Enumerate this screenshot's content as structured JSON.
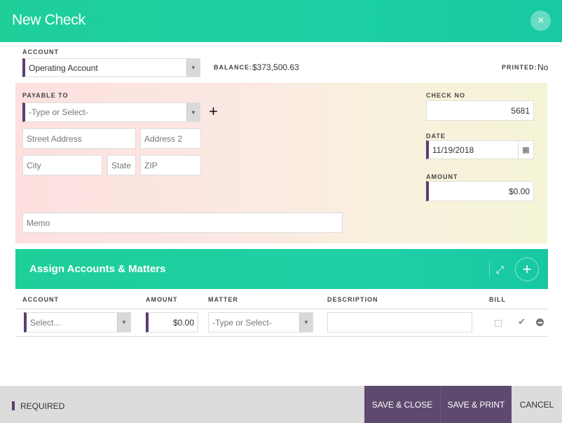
{
  "dialog": {
    "title": "New Check",
    "close_icon": "×"
  },
  "account": {
    "label": "ACCOUNT",
    "value": "Operating Account",
    "balance_label": "BALANCE:",
    "balance_value": "$373,500.63",
    "printed_label": "PRINTED:",
    "printed_value": "No"
  },
  "payable": {
    "label": "PAYABLE TO",
    "placeholder": "-Type or Select-",
    "street_placeholder": "Street Address",
    "address2_placeholder": "Address 2",
    "city_placeholder": "City",
    "state_placeholder": "State",
    "zip_placeholder": "ZIP",
    "memo_placeholder": "Memo"
  },
  "check": {
    "no_label": "CHECK NO",
    "no_value": "5681",
    "date_label": "DATE",
    "date_value": "11/19/2018",
    "amount_label": "AMOUNT",
    "amount_value": "$0.00"
  },
  "assign": {
    "title": "Assign Accounts & Matters",
    "columns": [
      "ACCOUNT",
      "AMOUNT",
      "MATTER",
      "DESCRIPTION",
      "BILL"
    ],
    "row": {
      "account_placeholder": "Select...",
      "amount": "$0.00",
      "matter_placeholder": "-Type or Select-"
    }
  },
  "footer": {
    "required": "REQUIRED",
    "save_close": "SAVE & CLOSE",
    "save_print": "SAVE & PRINT",
    "cancel": "CANCEL"
  },
  "colors": {
    "accent": "#1ecf9a",
    "required_marker": "#5a3f6e",
    "primary_button": "#5e4a6f"
  }
}
